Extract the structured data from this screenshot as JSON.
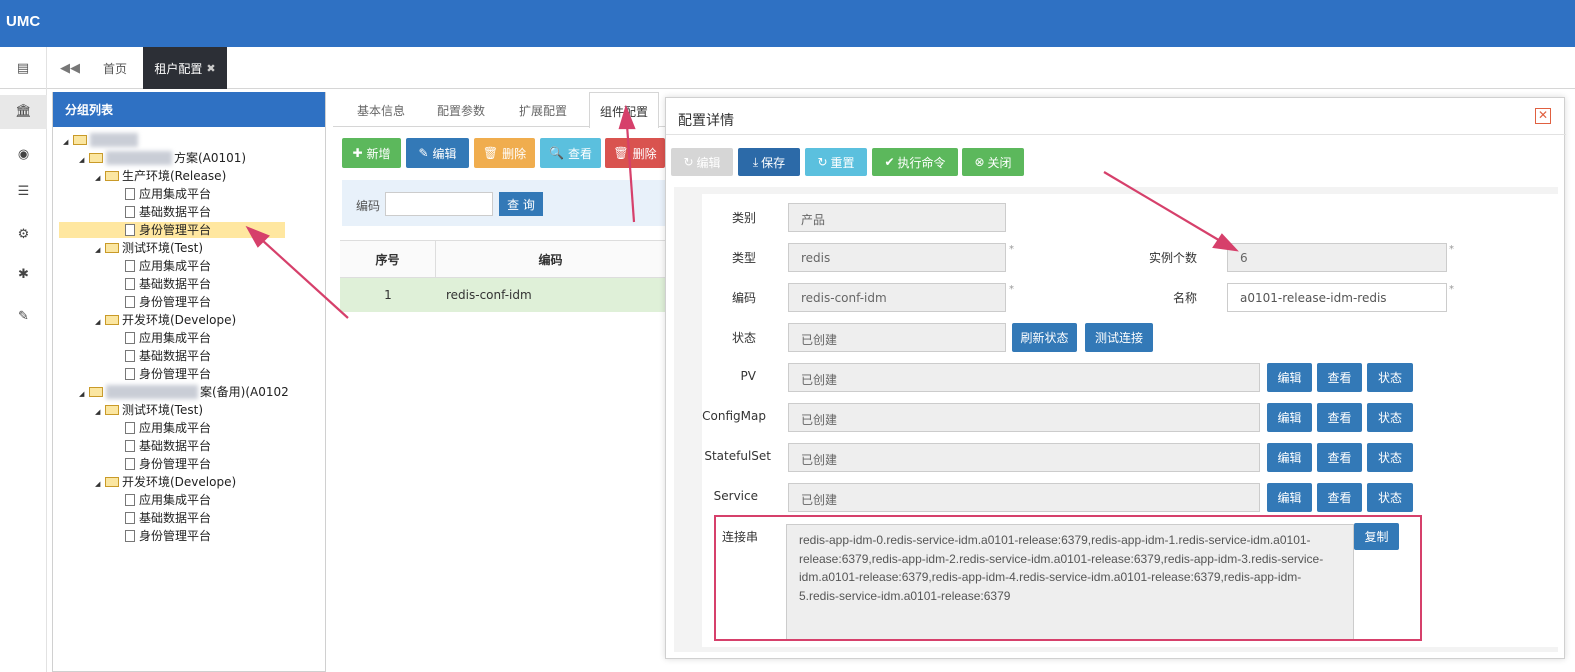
{
  "app": {
    "brand": "UMC"
  },
  "tabbar": {
    "menu_icon": "menu-icon",
    "collapse_icon": "double-left-icon",
    "tabs": [
      {
        "label": "首页"
      },
      {
        "label": "租户配置",
        "close": "✖"
      }
    ]
  },
  "iconbar": [
    "menu-icon",
    "bank-icon",
    "eye-icon",
    "list-icon",
    "gear-icon",
    "puzzle-icon",
    "wrench-icon"
  ],
  "tree": {
    "title": "分组列表",
    "tenant1_suffix": "方案(A0101)",
    "tenant2_suffix": "案(备用)(A0102",
    "env_release": "生产环境(Release)",
    "env_test": "测试环境(Test)",
    "env_develop": "开发环境(Develope)",
    "app1": "应用集成平台",
    "app2": "基础数据平台",
    "app3": "身份管理平台"
  },
  "subtabs": [
    "基本信息",
    "配置参数",
    "扩展配置",
    "组件配置"
  ],
  "toolbar": {
    "add": "新增",
    "edit": "编辑",
    "delete_orange": "删除",
    "view": "查看",
    "delete": "删除"
  },
  "search": {
    "label": "编码",
    "button": "查 询"
  },
  "grid": {
    "headers": [
      "序号",
      "编码"
    ],
    "rows": [
      {
        "index": "1",
        "code": "redis-conf-idm"
      }
    ]
  },
  "dialog": {
    "title": "配置详情",
    "close": "✕",
    "buttons": {
      "disabled": "编辑",
      "save": "保存",
      "reset": "重置",
      "exec": "执行命令",
      "close": "关闭"
    },
    "fields": {
      "category_label": "类别",
      "category_value": "产品",
      "type_label": "类型",
      "type_value": "redis",
      "instances_label": "实例个数",
      "instances_value": "6",
      "code_label": "编码",
      "code_value": "redis-conf-idm",
      "name_label": "名称",
      "name_value": "a0101-release-idm-redis",
      "status_label": "状态",
      "status_value": "已创建",
      "refresh_status": "刷新状态",
      "test_connect": "测试连接",
      "pv_label": "PV",
      "pv_value": "已创建",
      "configmap_label": "ConfigMap",
      "configmap_value": "已创建",
      "statefulset_label": "StatefulSet",
      "statefulset_value": "已创建",
      "service_label": "Service",
      "service_value": "已创建",
      "edit": "编辑",
      "view": "查看",
      "state": "状态",
      "conn_label": "连接串",
      "conn_value": "redis-app-idm-0.redis-service-idm.a0101-release:6379,redis-app-idm-1.redis-service-idm.a0101-release:6379,redis-app-idm-2.redis-service-idm.a0101-release:6379,redis-app-idm-3.redis-service-idm.a0101-release:6379,redis-app-idm-4.redis-service-idm.a0101-release:6379,redis-app-idm-5.redis-service-idm.a0101-release:6379",
      "copy": "复制"
    }
  },
  "colors": {
    "brand": "#2f71c3",
    "green": "#5cb85c",
    "blue": "#3379b7",
    "orange": "#f0ad4e",
    "cyan": "#5bc0de",
    "red": "#d9534f",
    "annotation": "#d6406b"
  }
}
